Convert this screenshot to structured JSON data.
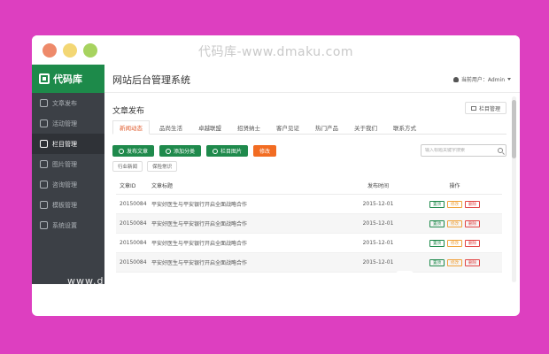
{
  "frame": {
    "site_title": "代码库-www.dmaku.com"
  },
  "sidebar": {
    "logo_text": "代码库",
    "items": [
      {
        "label": "文章发布",
        "icon": "edit-icon"
      },
      {
        "label": "活动管理",
        "icon": "calendar-icon"
      },
      {
        "label": "栏目管理",
        "icon": "columns-icon",
        "active": true
      },
      {
        "label": "图片管理",
        "icon": "image-icon"
      },
      {
        "label": "咨询管理",
        "icon": "chat-icon"
      },
      {
        "label": "模板管理",
        "icon": "template-icon"
      },
      {
        "label": "系统设置",
        "icon": "gear-icon"
      }
    ]
  },
  "header": {
    "title": "网站后台管理系统",
    "user_label": "当前用户：Admin"
  },
  "page": {
    "heading": "文章发布",
    "column_manage_button": "栏目管理",
    "tabs": [
      "新闻动态",
      "品尚生活",
      "卓越联盟",
      "招贤纳士",
      "客户见证",
      "热门产品",
      "关于我们",
      "联系方式"
    ],
    "active_tab": 0,
    "toolbar": {
      "publish": "发布文章",
      "add_category": "添加分类",
      "column_image": "栏目图片",
      "edit": "修改"
    },
    "search": {
      "placeholder": "输入标题关键字搜索"
    },
    "filters": [
      "行业新闻",
      "保险常识"
    ],
    "table": {
      "columns": [
        "文章ID",
        "文章标题",
        "发布时间",
        "操作"
      ],
      "ops": {
        "approve": "置顶",
        "edit": "修改",
        "delete": "删除"
      },
      "rows": [
        {
          "id": "20150084",
          "title": "平安好医生与平安银行开启全面战略合作",
          "date": "2015-12-01"
        },
        {
          "id": "20150084",
          "title": "平安好医生与平安银行开启全面战略合作",
          "date": "2015-12-01"
        },
        {
          "id": "20150084",
          "title": "平安好医生与平安银行开启全面战略合作",
          "date": "2015-12-01"
        },
        {
          "id": "20150084",
          "title": "平安好医生与平安银行开启全面战略合作",
          "date": "2015-12-01"
        }
      ]
    }
  },
  "watermark": {
    "url_text": "www.d",
    "logo_text": "代码库"
  },
  "colors": {
    "background": "#dd3fc0",
    "brand_green": "#1f8a4c",
    "active_tab": "#e05b2c",
    "orange_button": "#f26c22"
  }
}
